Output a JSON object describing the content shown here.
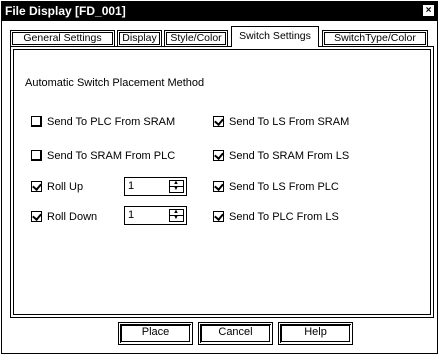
{
  "window": {
    "title": "File Display [FD_001]",
    "close_glyph": "×"
  },
  "tabs": [
    {
      "label": "General Settings",
      "active": false
    },
    {
      "label": "Display",
      "active": false
    },
    {
      "label": "Style/Color",
      "active": false
    },
    {
      "label": "Switch Settings",
      "active": true
    },
    {
      "label": "SwitchType/Color",
      "active": false
    }
  ],
  "panel": {
    "section_label": "Automatic Switch Placement Method",
    "left_options": [
      {
        "label": "Send To PLC From SRAM",
        "checked": false
      },
      {
        "label": "Send To SRAM From PLC",
        "checked": false
      },
      {
        "label": "Roll Up",
        "checked": true,
        "value": "1"
      },
      {
        "label": "Roll Down",
        "checked": true,
        "value": "1"
      }
    ],
    "right_options": [
      {
        "label": "Send To LS From SRAM",
        "checked": true
      },
      {
        "label": "Send To SRAM From LS",
        "checked": true
      },
      {
        "label": "Send To LS From PLC",
        "checked": true
      },
      {
        "label": "Send To PLC From LS",
        "checked": true
      }
    ]
  },
  "buttons": {
    "place": "Place",
    "cancel": "Cancel",
    "help": "Help"
  }
}
